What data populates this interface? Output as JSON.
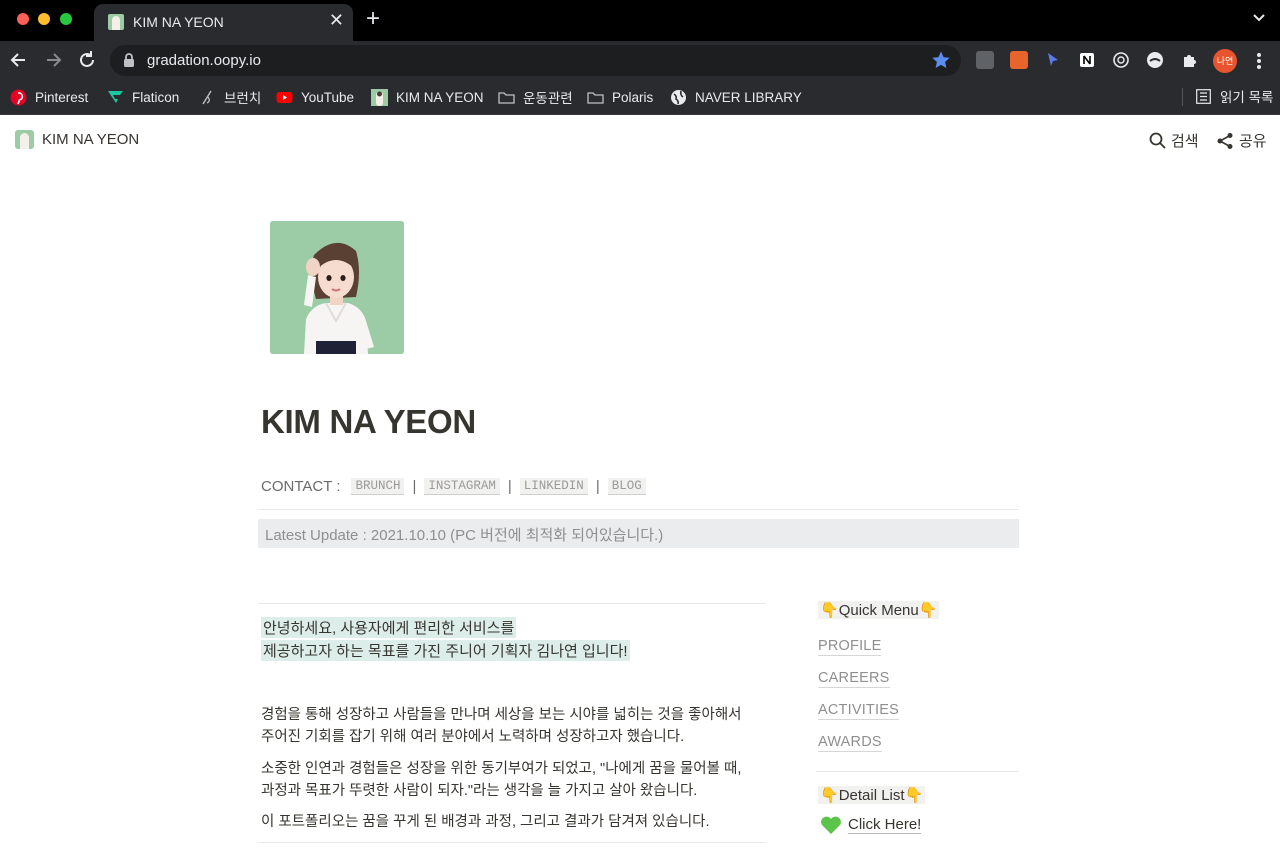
{
  "browser": {
    "tab_title": "KIM NA YEON",
    "url": "gradation.oopy.io",
    "profile_initials": "나연",
    "bookmarks": [
      {
        "label": "Pinterest",
        "icon": "pinterest-icon"
      },
      {
        "label": "Flaticon",
        "icon": "flaticon-icon"
      },
      {
        "label": "브런치",
        "icon": "brunch-icon"
      },
      {
        "label": "YouTube",
        "icon": "youtube-icon"
      },
      {
        "label": "KIM NA YEON",
        "icon": "site-favicon"
      },
      {
        "label": "운동관련",
        "icon": "folder-icon"
      },
      {
        "label": "Polaris",
        "icon": "folder-icon"
      },
      {
        "label": "NAVER LIBRARY",
        "icon": "globe-icon"
      }
    ],
    "reading_list": "읽기 목록"
  },
  "site": {
    "name": "KIM NA YEON",
    "search_label": "검색",
    "share_label": "공유"
  },
  "page": {
    "title": "KIM NA YEON",
    "contact_label": "CONTACT :",
    "contact_links": [
      "BRUNCH",
      "INSTAGRAM",
      "LINKEDIN",
      "BLOG"
    ],
    "latest_update": "Latest Update : 2021.10.10 (PC 버전에 최적화 되어있습니다.)",
    "intro_highlight": [
      "안녕하세요, 사용자에게 편리한 서비스를",
      "제공하고자 하는 목표를 가진 주니어 기획자 김나연 입니다!"
    ],
    "paragraphs": [
      "경험을 통해 성장하고 사람들을 만나며 세상을 보는 시야를 넓히는 것을 좋아해서",
      "주어진 기회를 잡기 위해 여러 분야에서 노력하며 성장하고자 했습니다.",
      "소중한 인연과 경험들은 성장을 위한 동기부여가 되었고, \"나에게 꿈을 물어볼 때,",
      "과정과 목표가 뚜렷한 사람이 되자.\"라는 생각을 늘 가지고 살아 왔습니다.",
      "이 포트폴리오는 꿈을 꾸게 된 배경과 과정, 그리고 결과가 담겨져 있습니다."
    ],
    "quick_menu_title": "Quick Menu",
    "quick_menu": [
      "PROFILE",
      "CAREERS",
      "ACTIVITIES",
      "AWARDS"
    ],
    "detail_list_title": "Detail List",
    "detail_link": "Click Here!"
  },
  "colors": {
    "highlight_teal": "#ddedea",
    "avatar_bg": "#9ccca6",
    "update_bg": "#ebeced",
    "heart_green": "#5cc44a"
  }
}
